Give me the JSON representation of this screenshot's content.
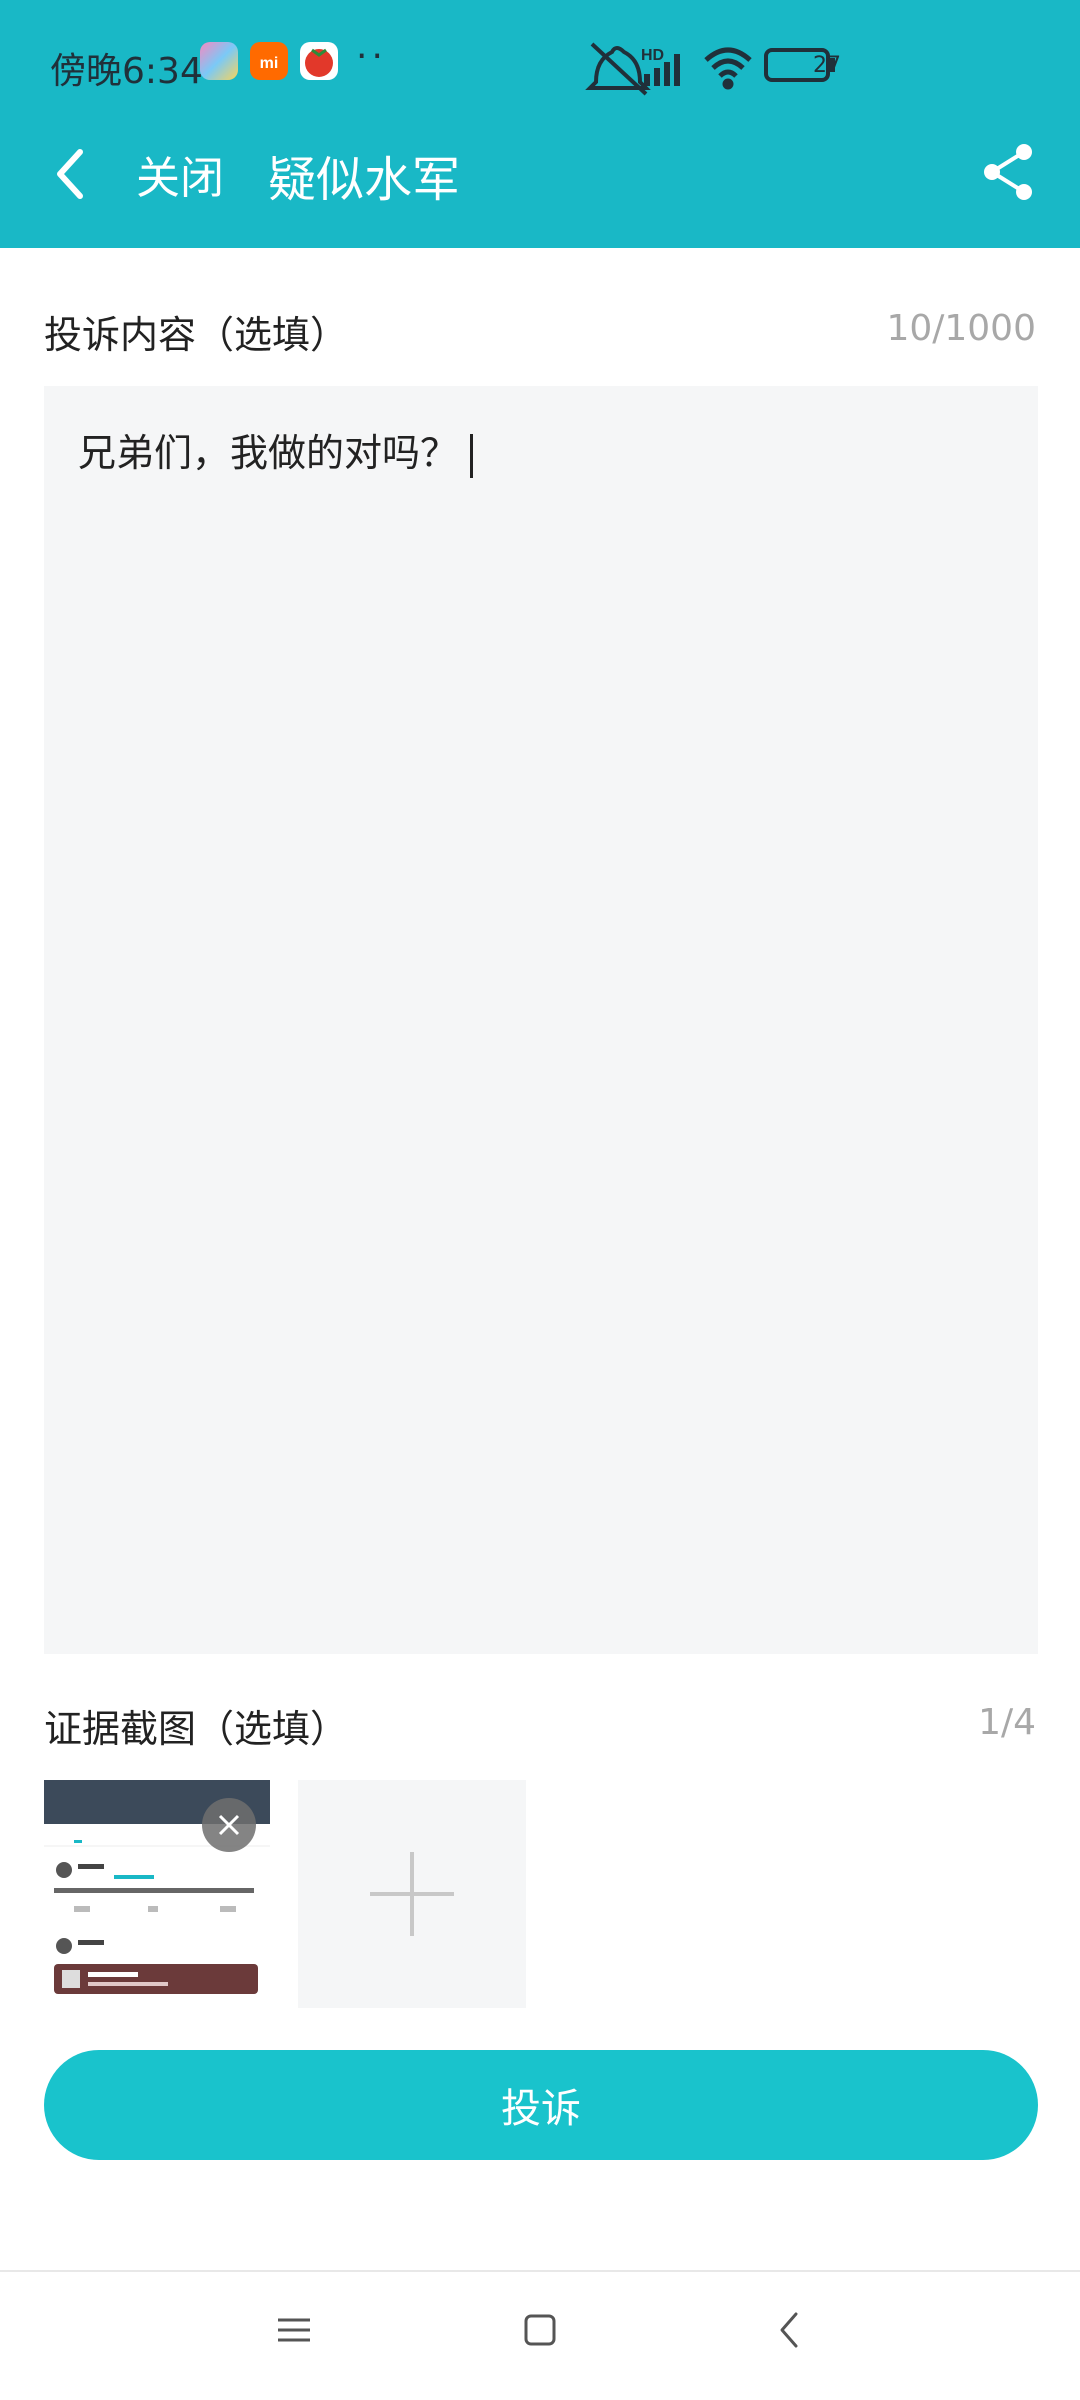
{
  "status_bar": {
    "time": "傍晚6:34",
    "notification_dots": "··",
    "battery": "27",
    "network": "HD"
  },
  "nav": {
    "close_label": "关闭",
    "title": "疑似水军"
  },
  "complaint": {
    "label": "投诉内容（选填）",
    "counter": "10/1000",
    "text": "兄弟们，我做的对吗？"
  },
  "evidence": {
    "label": "证据截图（选填）",
    "counter": "1/4"
  },
  "submit_label": "投诉",
  "colors": {
    "header": "#19b8c6",
    "button": "#19c3cc",
    "textarea_bg": "#f5f6f7"
  }
}
